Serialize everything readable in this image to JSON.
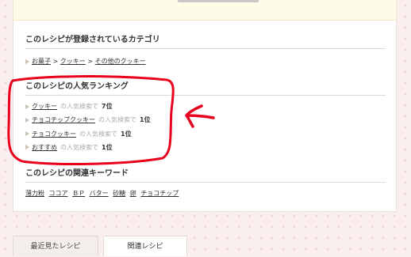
{
  "category_section": {
    "title": "このレシピが登録されているカテゴリ",
    "breadcrumbs": [
      "お菓子",
      "クッキー",
      "その他のクッキー"
    ],
    "separator": ">"
  },
  "ranking_section": {
    "title": "このレシピの人気ランキング",
    "rows": [
      {
        "name": "クッキー",
        "middle": "の人気検索で",
        "rank": "7位"
      },
      {
        "name": "チョコチップクッキー",
        "middle": "の人気検索で",
        "rank": "1位"
      },
      {
        "name": "チョコクッキー",
        "middle": "の人気検索で",
        "rank": "1位"
      },
      {
        "name": "おすすめ",
        "middle": "の人気検索で",
        "rank": "1位"
      }
    ]
  },
  "keyword_section": {
    "title": "このレシピの関連キーワード",
    "keywords": [
      "薄力粉",
      "ココア",
      "ＢＰ",
      "バター",
      "砂糖",
      "卵",
      "チョコチップ"
    ]
  },
  "tabs": {
    "recent": "最近見たレシピ",
    "related": "関連レシピ"
  },
  "annotation_color": "#e8001c"
}
